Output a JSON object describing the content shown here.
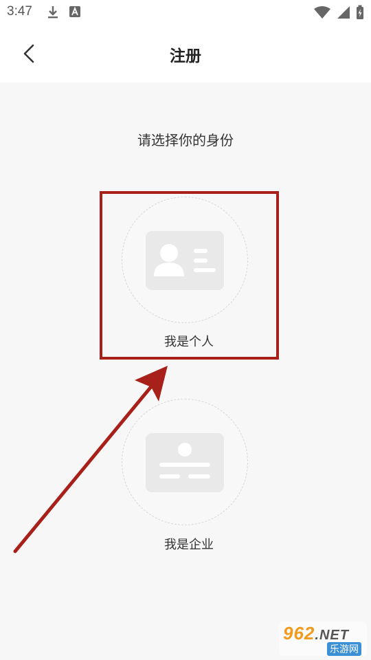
{
  "status_bar": {
    "time": "3:47",
    "icons": [
      "download-icon",
      "font-a-icon",
      "wifi-icon",
      "signal-icon",
      "battery-charging-icon"
    ]
  },
  "header": {
    "title": "注册",
    "back_icon": "chevron-left-icon"
  },
  "main": {
    "prompt": "请选择你的身份",
    "options": [
      {
        "label": "我是个人",
        "icon": "id-card-person-icon"
      },
      {
        "label": "我是企业",
        "icon": "business-card-icon"
      }
    ]
  },
  "annotation": {
    "highlight_color": "#a8201a",
    "arrow_color": "#a8201a"
  },
  "watermark": {
    "number": "962",
    "suffix": ".NET",
    "subtitle": "乐游网"
  }
}
